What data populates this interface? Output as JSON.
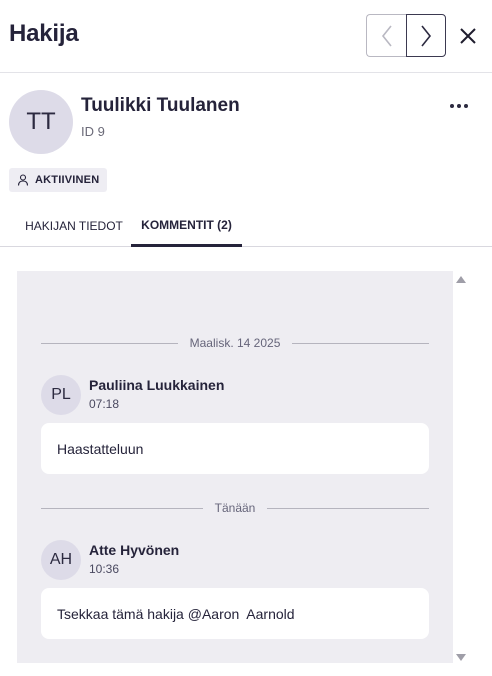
{
  "header": {
    "title": "Hakija",
    "prev_label": "Previous",
    "next_label": "Next",
    "close_label": "Close"
  },
  "profile": {
    "initials": "TT",
    "name": "Tuulikki Tuulanen",
    "id_text": "ID 9",
    "status": "AKTIIVINEN"
  },
  "tabs": [
    {
      "label": "HAKIJAN TIEDOT",
      "active": false
    },
    {
      "label": "KOMMENTIT (2)",
      "active": true
    }
  ],
  "comments": [
    {
      "date": "Maalisk. 14 2025",
      "initials": "PL",
      "author": "Pauliina Luukkainen",
      "time": "07:18",
      "text": "Haastatteluun"
    },
    {
      "date": "Tänään",
      "initials": "AH",
      "author": "Atte Hyvönen",
      "time": "10:36",
      "text": "Tsekkaa tämä hakija @Aaron  Aarnold"
    }
  ],
  "icons": {
    "prev": "chevron-left-icon",
    "next": "chevron-right-icon",
    "close": "close-icon",
    "more": "more-horizontal-icon",
    "status": "person-icon"
  },
  "colors": {
    "text": "#25233a",
    "avatar_bg": "#dddbe8",
    "panel_bg": "#eeedf2"
  }
}
